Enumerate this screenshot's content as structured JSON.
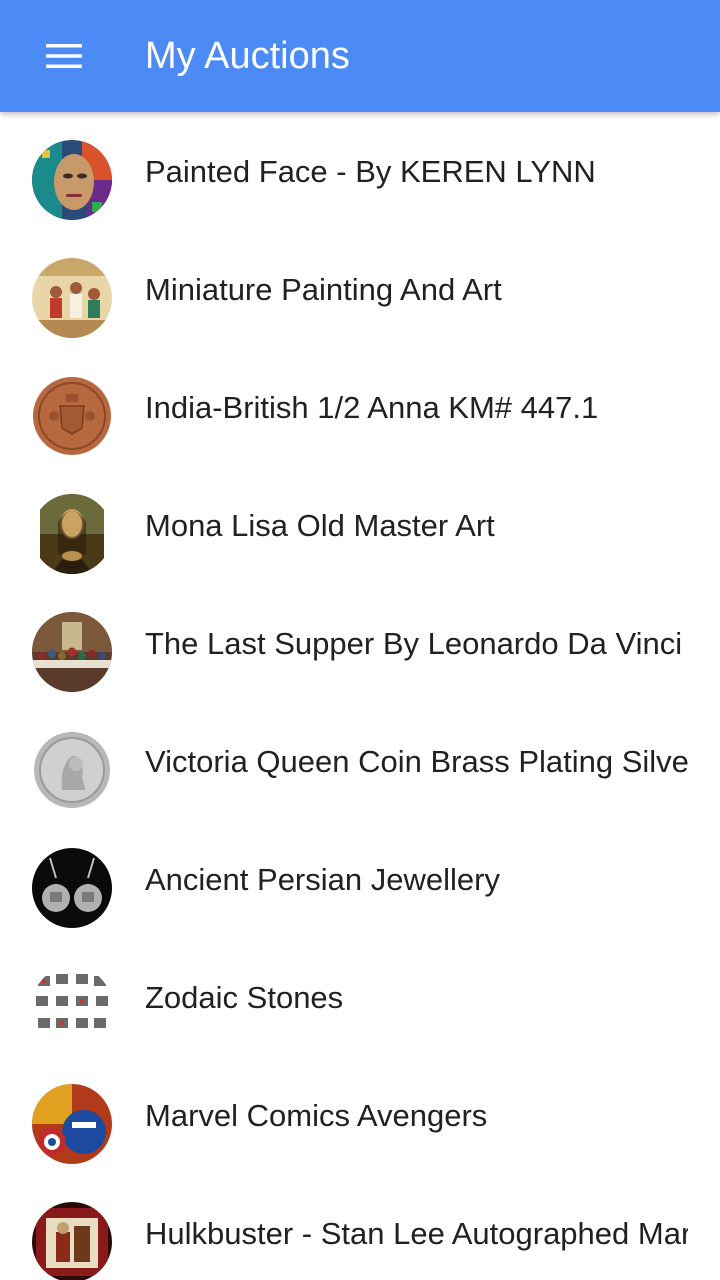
{
  "app_bar": {
    "title": "My Auctions",
    "menu_icon": "hamburger-menu-icon",
    "color": "#4c8bf5"
  },
  "auctions": [
    {
      "title": "Painted Face - By KEREN LYNN"
    },
    {
      "title": "Miniature Painting And Art"
    },
    {
      "title": "India-British 1/2 Anna KM# 447.1"
    },
    {
      "title": "Mona Lisa Old Master Art"
    },
    {
      "title": "The Last Supper By Leonardo Da Vinci"
    },
    {
      "title": "Victoria Queen Coin Brass Plating Silver"
    },
    {
      "title": "Ancient Persian Jewellery"
    },
    {
      "title": "Zodaic Stones"
    },
    {
      "title": "Marvel Comics Avengers"
    },
    {
      "title": "Hulkbuster - Stan Lee Autographed Marvel"
    }
  ]
}
